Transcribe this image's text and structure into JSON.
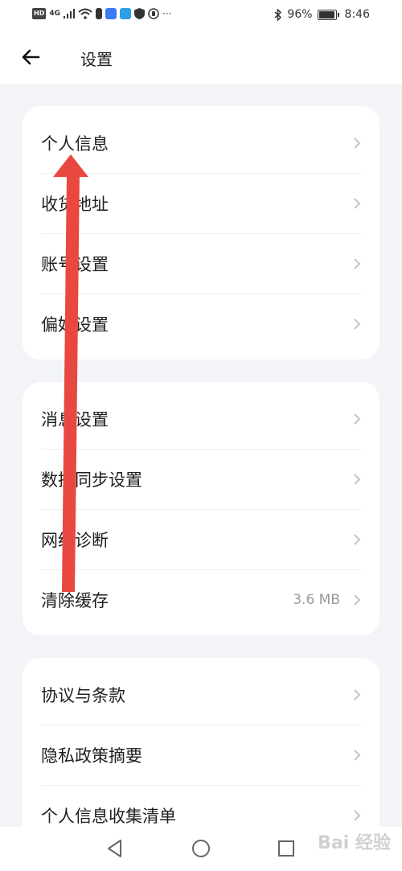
{
  "status_bar": {
    "hd_badge": "HD",
    "network_label": "4G",
    "battery_pct": "96%",
    "time": "8:46",
    "more": "···"
  },
  "header": {
    "title": "设置"
  },
  "groups": [
    {
      "items": [
        {
          "label": "个人信息"
        },
        {
          "label": "收货地址"
        },
        {
          "label": "账号设置"
        },
        {
          "label": "偏好设置"
        }
      ]
    },
    {
      "items": [
        {
          "label": "消息设置"
        },
        {
          "label": "数据同步设置"
        },
        {
          "label": "网络诊断"
        },
        {
          "label": "清除缓存",
          "value": "3.6 MB"
        }
      ]
    },
    {
      "items": [
        {
          "label": "协议与条款"
        },
        {
          "label": "隐私政策摘要"
        },
        {
          "label": "个人信息收集清单"
        }
      ]
    }
  ],
  "annotation": {
    "arrow_color": "#e8483f"
  },
  "watermark": {
    "text": "Bai 经验"
  }
}
